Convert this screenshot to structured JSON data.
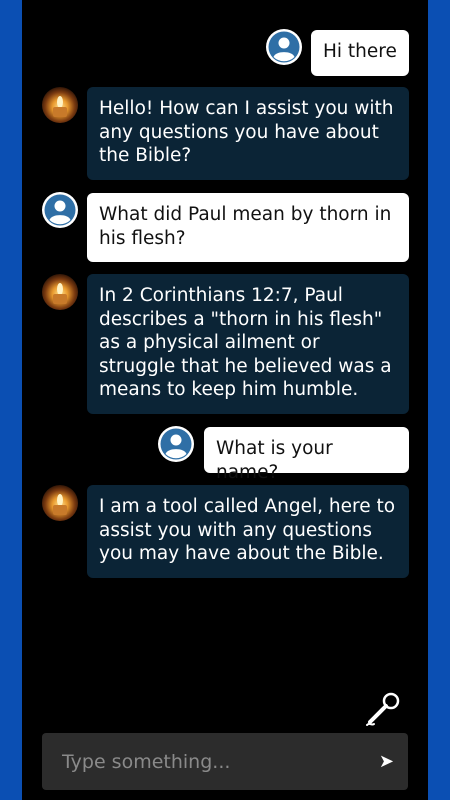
{
  "messages": [
    {
      "sender": "user",
      "text": "Hi there"
    },
    {
      "sender": "bot",
      "text": "Hello! How can I assist you with any questions you have about the Bible?"
    },
    {
      "sender": "user",
      "text": "What did Paul mean by thorn in his flesh?"
    },
    {
      "sender": "bot",
      "text": "In 2 Corinthians 12:7, Paul describes a \"thorn in his flesh\" as a physical ailment or struggle that he believed was a means to keep him humble."
    },
    {
      "sender": "user",
      "text": "What is your name?"
    },
    {
      "sender": "bot",
      "text": "I am a tool called Angel, here to assist you with any questions you may have about the Bible."
    }
  ],
  "composer": {
    "placeholder": "Type something...",
    "send_icon": "send-icon",
    "mic_icon": "microphone-icon"
  },
  "colors": {
    "frame": "#0b4fb3",
    "bot_bubble": "#0b2436",
    "user_bubble": "#ffffff",
    "user_avatar": "#2f6fa6"
  }
}
